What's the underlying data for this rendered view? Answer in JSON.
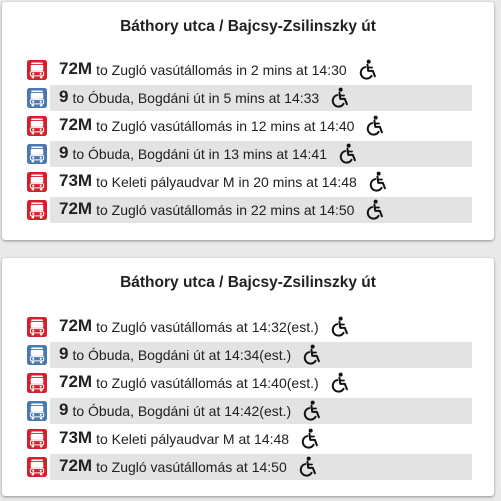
{
  "colors": {
    "bus_red": "#d32029",
    "trolley_blue": "#4a78b0",
    "stripe": "#e3e3e3"
  },
  "card1": {
    "title": "Báthory utca / Bajcsy-Zsilinszky út",
    "rows": [
      {
        "icon": "bus-icon",
        "line": "72M",
        "text": "to Zugló vasútállomás in 2 mins at 14:30",
        "wheelchair": true,
        "alt": false
      },
      {
        "icon": "trolleybus-icon",
        "line": "9",
        "text": "to Óbuda, Bogdáni út in 5 mins at 14:33",
        "wheelchair": true,
        "alt": true
      },
      {
        "icon": "bus-icon",
        "line": "72M",
        "text": "to Zugló vasútállomás in 12 mins at 14:40",
        "wheelchair": true,
        "alt": false
      },
      {
        "icon": "trolleybus-icon",
        "line": "9",
        "text": "to Óbuda, Bogdáni út in 13 mins at 14:41",
        "wheelchair": true,
        "alt": true
      },
      {
        "icon": "bus-icon",
        "line": "73M",
        "text": "to Keleti pályaudvar M in 20 mins at 14:48",
        "wheelchair": true,
        "alt": false
      },
      {
        "icon": "bus-icon",
        "line": "72M",
        "text": "to Zugló vasútállomás in 22 mins at 14:50",
        "wheelchair": true,
        "alt": true
      }
    ]
  },
  "card2": {
    "title": "Báthory utca / Bajcsy-Zsilinszky út",
    "rows": [
      {
        "icon": "bus-icon",
        "line": "72M",
        "text": "to Zugló vasútállomás at 14:32(est.)",
        "wheelchair": true,
        "alt": false
      },
      {
        "icon": "trolleybus-icon",
        "line": "9",
        "text": "to Óbuda, Bogdáni út at 14:34(est.)",
        "wheelchair": true,
        "alt": true
      },
      {
        "icon": "bus-icon",
        "line": "72M",
        "text": "to Zugló vasútállomás at 14:40(est.)",
        "wheelchair": true,
        "alt": false
      },
      {
        "icon": "trolleybus-icon",
        "line": "9",
        "text": "to Óbuda, Bogdáni út at 14:42(est.)",
        "wheelchair": true,
        "alt": true
      },
      {
        "icon": "bus-icon",
        "line": "73M",
        "text": "to Keleti pályaudvar M at 14:48",
        "wheelchair": true,
        "alt": false
      },
      {
        "icon": "bus-icon",
        "line": "72M",
        "text": "to Zugló vasútállomás at 14:50",
        "wheelchair": true,
        "alt": true
      }
    ]
  }
}
